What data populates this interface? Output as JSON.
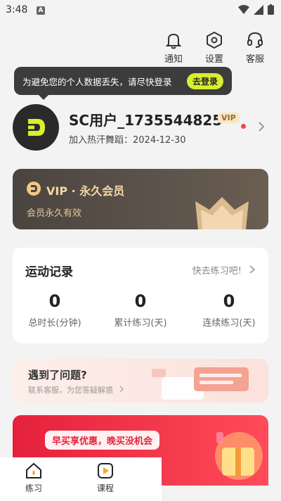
{
  "status_bar": {
    "time": "3:48",
    "app_badge": "A"
  },
  "top_actions": [
    {
      "label": "通知",
      "icon": "bell-icon"
    },
    {
      "label": "设置",
      "icon": "settings-hexagon-icon"
    },
    {
      "label": "客服",
      "icon": "headset-icon"
    }
  ],
  "tooltip": {
    "text": "为避免您的个人数据丢失，请尽快登录",
    "button": "去登录"
  },
  "profile": {
    "username": "SC用户_1735544825",
    "vip_tag": "VIP",
    "join_label": "加入热汗舞蹈：",
    "join_date": "2024-12-30"
  },
  "vip_card": {
    "title": "VIP · 永久会员",
    "subtitle": "会员永久有效"
  },
  "exercise": {
    "title": "运动记录",
    "link": "快去练习吧!",
    "stats": [
      {
        "value": "0",
        "label": "总时长(分钟)"
      },
      {
        "value": "0",
        "label": "累计练习(天)"
      },
      {
        "value": "0",
        "label": "连续练习(天)"
      }
    ]
  },
  "help_card": {
    "title": "遇到了问题?",
    "subtitle": "联系客服，为您答疑解惑"
  },
  "promo": {
    "pill": "早买享优惠，晚买没机会"
  },
  "tabs": [
    {
      "label": "练习",
      "icon": "house-icon"
    },
    {
      "label": "课程",
      "icon": "play-square-icon"
    }
  ],
  "colors": {
    "accent": "#d7ef2f",
    "vip_gold": "#f5d9a8",
    "promo_red": "#e5213b"
  }
}
